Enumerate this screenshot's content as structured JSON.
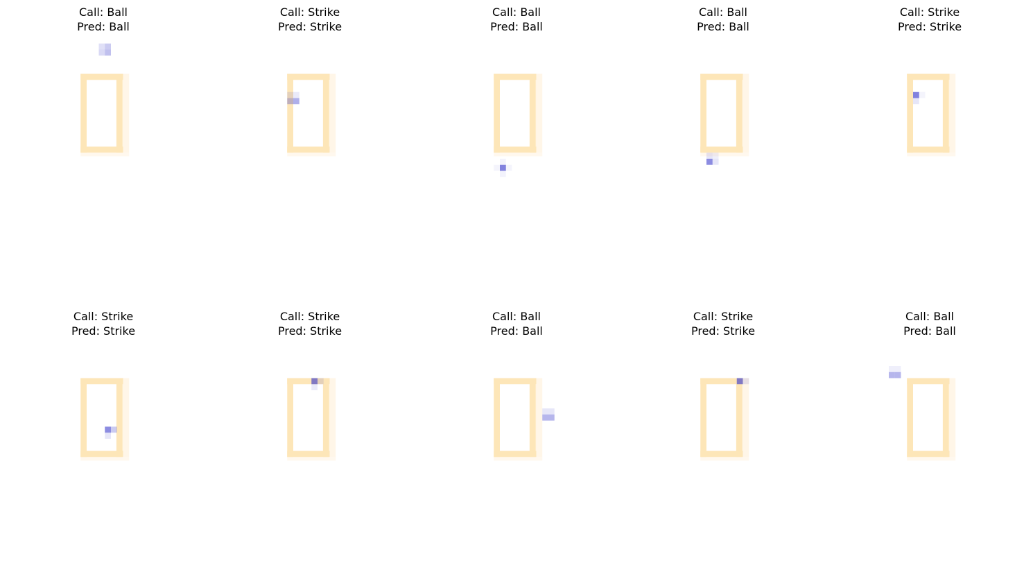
{
  "chart_data": {
    "type": "heatmap",
    "description_grid": "Each panel is a 17-column x 33-row image. Zone cells form the strike-zone outline; pitch cells mark the pitch location with its intensity (0-1).",
    "zone": {
      "color": "#fde6b8",
      "shadow_color": "#fff4e2",
      "cols": [
        1,
        7
      ],
      "rows": [
        6,
        18
      ]
    },
    "pitch_color": "#2e2ec8",
    "panels": [
      {
        "call": "Ball",
        "pred": "Ball",
        "pitch": [
          [
            4,
            1,
            0.15
          ],
          [
            5,
            1,
            0.25
          ],
          [
            4,
            2,
            0.18
          ],
          [
            5,
            2,
            0.3
          ]
        ]
      },
      {
        "call": "Strike",
        "pred": "Strike",
        "pitch": [
          [
            1,
            9,
            0.12
          ],
          [
            2,
            9,
            0.1
          ],
          [
            1,
            10,
            0.3
          ],
          [
            2,
            10,
            0.38
          ]
        ]
      },
      {
        "call": "Ball",
        "pred": "Ball",
        "pitch": [
          [
            2,
            20,
            0.06
          ],
          [
            1,
            21,
            0.05
          ],
          [
            2,
            21,
            0.6
          ],
          [
            3,
            21,
            0.05
          ],
          [
            2,
            22,
            0.06
          ]
        ]
      },
      {
        "call": "Ball",
        "pred": "Ball",
        "pitch": [
          [
            2,
            19,
            0.12
          ],
          [
            3,
            19,
            0.08
          ],
          [
            2,
            20,
            0.55
          ],
          [
            3,
            20,
            0.12
          ]
        ]
      },
      {
        "call": "Strike",
        "pred": "Strike",
        "pitch": [
          [
            2,
            9,
            0.6
          ],
          [
            3,
            9,
            0.05
          ],
          [
            2,
            10,
            0.12
          ]
        ]
      },
      {
        "call": "Strike",
        "pred": "Strike",
        "pitch": [
          [
            5,
            14,
            0.55
          ],
          [
            6,
            14,
            0.25
          ],
          [
            5,
            15,
            0.12
          ]
        ]
      },
      {
        "call": "Strike",
        "pred": "Strike",
        "pitch": [
          [
            5,
            6,
            0.6
          ],
          [
            6,
            6,
            0.12
          ],
          [
            5,
            7,
            0.1
          ]
        ]
      },
      {
        "call": "Ball",
        "pred": "Ball",
        "pitch": [
          [
            9,
            11,
            0.12
          ],
          [
            10,
            11,
            0.12
          ],
          [
            9,
            12,
            0.35
          ],
          [
            10,
            12,
            0.35
          ]
        ]
      },
      {
        "call": "Strike",
        "pred": "Strike",
        "pitch": [
          [
            7,
            6,
            0.6
          ],
          [
            8,
            6,
            0.12
          ]
        ]
      },
      {
        "call": "Ball",
        "pred": "Ball",
        "pitch": [
          [
            -2,
            4,
            0.08
          ],
          [
            -1,
            4,
            0.08
          ],
          [
            -2,
            5,
            0.35
          ],
          [
            -1,
            5,
            0.35
          ]
        ]
      }
    ]
  },
  "labels": {
    "call_prefix": "Call: ",
    "pred_prefix": "Pred: "
  }
}
